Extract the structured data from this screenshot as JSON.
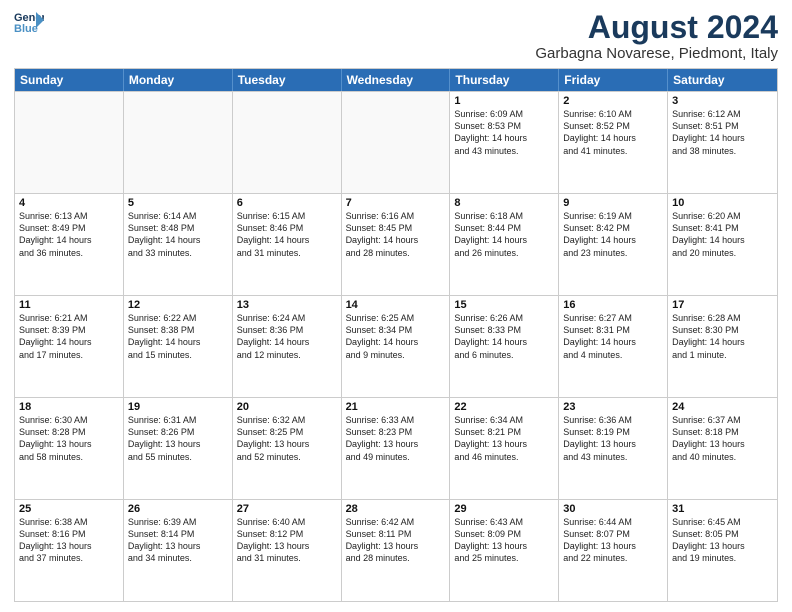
{
  "logo": {
    "line1": "General",
    "line2": "Blue"
  },
  "title": "August 2024",
  "location": "Garbagna Novarese, Piedmont, Italy",
  "header_days": [
    "Sunday",
    "Monday",
    "Tuesday",
    "Wednesday",
    "Thursday",
    "Friday",
    "Saturday"
  ],
  "rows": [
    [
      {
        "day": "",
        "text": ""
      },
      {
        "day": "",
        "text": ""
      },
      {
        "day": "",
        "text": ""
      },
      {
        "day": "",
        "text": ""
      },
      {
        "day": "1",
        "text": "Sunrise: 6:09 AM\nSunset: 8:53 PM\nDaylight: 14 hours\nand 43 minutes."
      },
      {
        "day": "2",
        "text": "Sunrise: 6:10 AM\nSunset: 8:52 PM\nDaylight: 14 hours\nand 41 minutes."
      },
      {
        "day": "3",
        "text": "Sunrise: 6:12 AM\nSunset: 8:51 PM\nDaylight: 14 hours\nand 38 minutes."
      }
    ],
    [
      {
        "day": "4",
        "text": "Sunrise: 6:13 AM\nSunset: 8:49 PM\nDaylight: 14 hours\nand 36 minutes."
      },
      {
        "day": "5",
        "text": "Sunrise: 6:14 AM\nSunset: 8:48 PM\nDaylight: 14 hours\nand 33 minutes."
      },
      {
        "day": "6",
        "text": "Sunrise: 6:15 AM\nSunset: 8:46 PM\nDaylight: 14 hours\nand 31 minutes."
      },
      {
        "day": "7",
        "text": "Sunrise: 6:16 AM\nSunset: 8:45 PM\nDaylight: 14 hours\nand 28 minutes."
      },
      {
        "day": "8",
        "text": "Sunrise: 6:18 AM\nSunset: 8:44 PM\nDaylight: 14 hours\nand 26 minutes."
      },
      {
        "day": "9",
        "text": "Sunrise: 6:19 AM\nSunset: 8:42 PM\nDaylight: 14 hours\nand 23 minutes."
      },
      {
        "day": "10",
        "text": "Sunrise: 6:20 AM\nSunset: 8:41 PM\nDaylight: 14 hours\nand 20 minutes."
      }
    ],
    [
      {
        "day": "11",
        "text": "Sunrise: 6:21 AM\nSunset: 8:39 PM\nDaylight: 14 hours\nand 17 minutes."
      },
      {
        "day": "12",
        "text": "Sunrise: 6:22 AM\nSunset: 8:38 PM\nDaylight: 14 hours\nand 15 minutes."
      },
      {
        "day": "13",
        "text": "Sunrise: 6:24 AM\nSunset: 8:36 PM\nDaylight: 14 hours\nand 12 minutes."
      },
      {
        "day": "14",
        "text": "Sunrise: 6:25 AM\nSunset: 8:34 PM\nDaylight: 14 hours\nand 9 minutes."
      },
      {
        "day": "15",
        "text": "Sunrise: 6:26 AM\nSunset: 8:33 PM\nDaylight: 14 hours\nand 6 minutes."
      },
      {
        "day": "16",
        "text": "Sunrise: 6:27 AM\nSunset: 8:31 PM\nDaylight: 14 hours\nand 4 minutes."
      },
      {
        "day": "17",
        "text": "Sunrise: 6:28 AM\nSunset: 8:30 PM\nDaylight: 14 hours\nand 1 minute."
      }
    ],
    [
      {
        "day": "18",
        "text": "Sunrise: 6:30 AM\nSunset: 8:28 PM\nDaylight: 13 hours\nand 58 minutes."
      },
      {
        "day": "19",
        "text": "Sunrise: 6:31 AM\nSunset: 8:26 PM\nDaylight: 13 hours\nand 55 minutes."
      },
      {
        "day": "20",
        "text": "Sunrise: 6:32 AM\nSunset: 8:25 PM\nDaylight: 13 hours\nand 52 minutes."
      },
      {
        "day": "21",
        "text": "Sunrise: 6:33 AM\nSunset: 8:23 PM\nDaylight: 13 hours\nand 49 minutes."
      },
      {
        "day": "22",
        "text": "Sunrise: 6:34 AM\nSunset: 8:21 PM\nDaylight: 13 hours\nand 46 minutes."
      },
      {
        "day": "23",
        "text": "Sunrise: 6:36 AM\nSunset: 8:19 PM\nDaylight: 13 hours\nand 43 minutes."
      },
      {
        "day": "24",
        "text": "Sunrise: 6:37 AM\nSunset: 8:18 PM\nDaylight: 13 hours\nand 40 minutes."
      }
    ],
    [
      {
        "day": "25",
        "text": "Sunrise: 6:38 AM\nSunset: 8:16 PM\nDaylight: 13 hours\nand 37 minutes."
      },
      {
        "day": "26",
        "text": "Sunrise: 6:39 AM\nSunset: 8:14 PM\nDaylight: 13 hours\nand 34 minutes."
      },
      {
        "day": "27",
        "text": "Sunrise: 6:40 AM\nSunset: 8:12 PM\nDaylight: 13 hours\nand 31 minutes."
      },
      {
        "day": "28",
        "text": "Sunrise: 6:42 AM\nSunset: 8:11 PM\nDaylight: 13 hours\nand 28 minutes."
      },
      {
        "day": "29",
        "text": "Sunrise: 6:43 AM\nSunset: 8:09 PM\nDaylight: 13 hours\nand 25 minutes."
      },
      {
        "day": "30",
        "text": "Sunrise: 6:44 AM\nSunset: 8:07 PM\nDaylight: 13 hours\nand 22 minutes."
      },
      {
        "day": "31",
        "text": "Sunrise: 6:45 AM\nSunset: 8:05 PM\nDaylight: 13 hours\nand 19 minutes."
      }
    ]
  ]
}
